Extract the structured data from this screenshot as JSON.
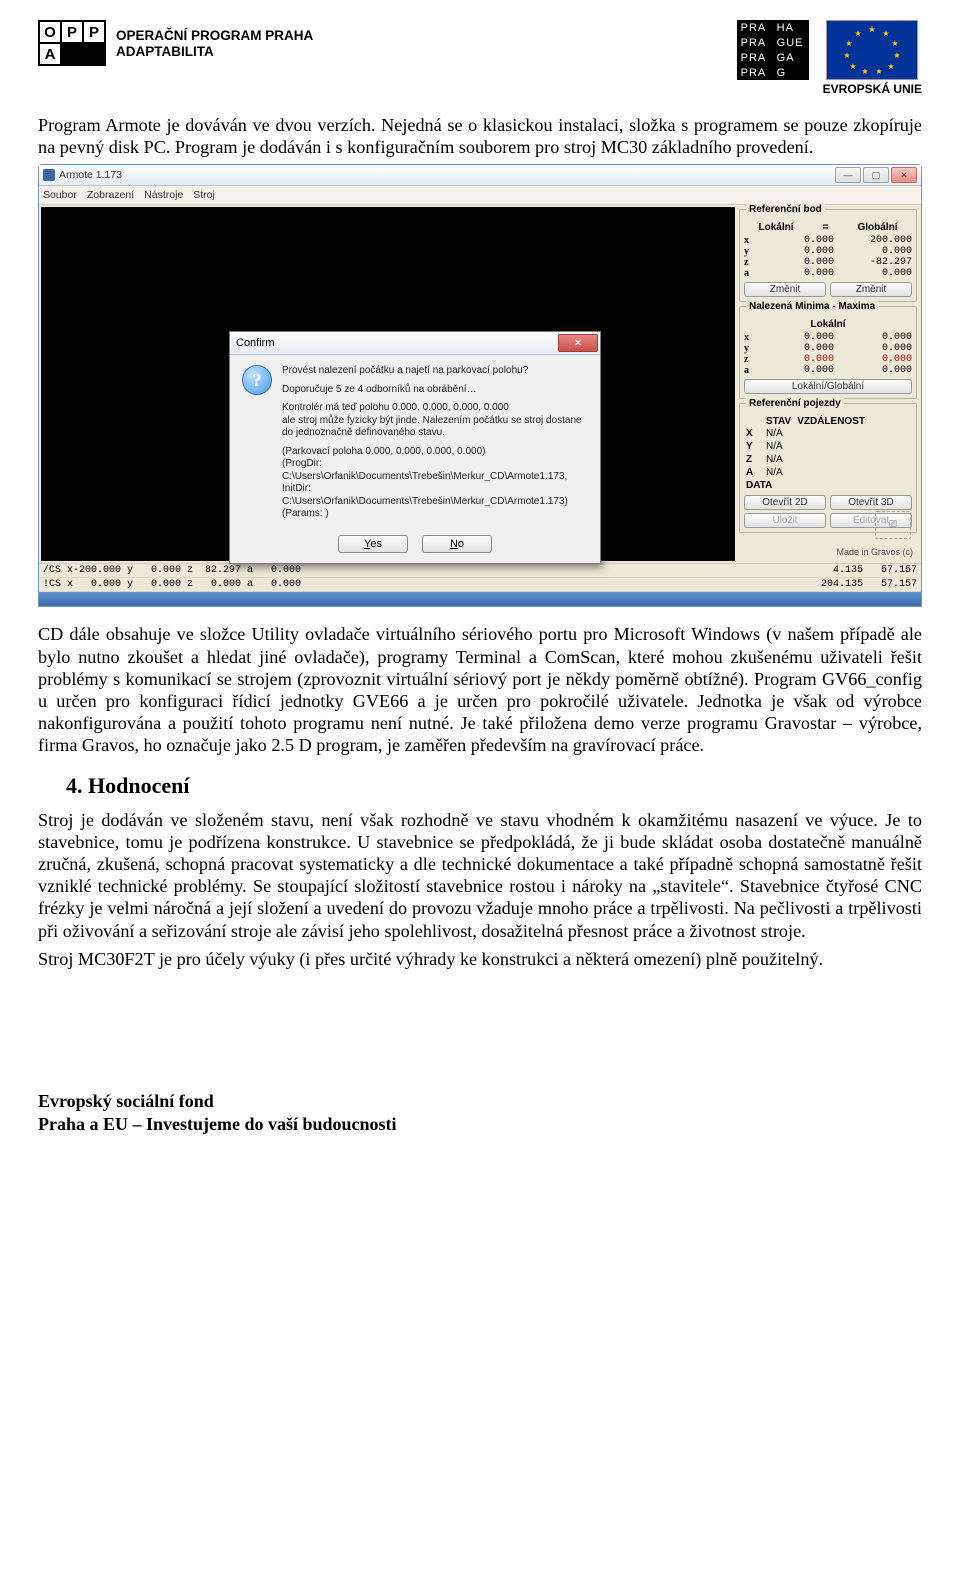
{
  "header": {
    "opp_letters": [
      "O",
      "P",
      "P",
      "A",
      "",
      ""
    ],
    "opp_title_l1": "OPERAČNÍ PROGRAM PRAHA",
    "opp_title_l2": "ADAPTABILITA",
    "praha_cells": [
      "PRA",
      "HA",
      "PRA",
      "GUE",
      "PRA",
      "GA",
      "PRA",
      "G"
    ],
    "eu_label": "EVROPSKÁ UNIE"
  },
  "body": {
    "p1": "Program Armote je dováván ve dvou verzích. Nejedná se o klasickou instalaci, složka s programem se pouze zkopíruje na pevný disk PC. Program je dodáván i s konfiguračním souborem pro stroj MC30 základního provedení.",
    "p2": "CD dále obsahuje ve složce Utility ovladače virtuálního sériového portu pro Microsoft Windows (v našem případě ale bylo nutno zkoušet a hledat jiné ovladače), programy Terminal a ComScan, které mohou zkušenému uživateli řešit problémy s komunikací se strojem (zprovoznit virtuální sériový port je někdy poměrně obtížné). Program GV66_config u určen pro konfiguraci řídicí jednotky GVE66 a je určen pro pokročilé uživatele. Jednotka je však od výrobce nakonfigurována a použití tohoto programu není nutné. Je také přiložena demo verze programu Gravostar – výrobce, firma Gravos, ho označuje jako 2.5 D program, je zaměřen především na gravírovací práce.",
    "h2": "4. Hodnocení",
    "p3": "Stroj je dodáván ve složeném stavu, není však rozhodně ve stavu vhodném k okamžitému nasazení ve výuce. Je to stavebnice, tomu je podřízena konstrukce. U stavebnice se předpokládá, že ji bude skládat osoba dostatečně manuálně zručná, zkušená, schopná pracovat systematicky a dle technické dokumentace a také případně schopná samostatně řešit vzniklé technické problémy. Se stoupající složitostí stavebnice rostou i nároky na „stavitele“. Stavebnice čtyřosé CNC frézky je velmi náročná a její složení a uvedení do provozu vžaduje mnoho práce a trpělivosti. Na pečlivosti a trpělivosti při oživování a seřizování stroje ale závisí jeho spolehlivost, dosažitelná přesnost práce a životnost stroje.",
    "p4": "Stroj MC30F2T je pro účely výuky (i přes určité výhrady ke konstrukci a některá omezení) plně použitelný."
  },
  "footer": {
    "l1": "Evropský sociální fond",
    "l2": "Praha a EU – Investujeme do vaší budoucnosti"
  },
  "app": {
    "title": "Armote 1.173",
    "menu": [
      "Soubor",
      "Zobrazení",
      "Nástroje",
      "Stroj"
    ],
    "made": "Made in Gravos (c)",
    "panels": {
      "ref_point": {
        "title": "Referenční bod",
        "cols": [
          "Lokální",
          "=",
          "Globální"
        ],
        "rows": [
          {
            "axis": "x",
            "local": "0.000",
            "global": "200.000"
          },
          {
            "axis": "y",
            "local": "0.000",
            "global": "0.000"
          },
          {
            "axis": "z",
            "local": "0.000",
            "global": "-82.297"
          },
          {
            "axis": "a",
            "local": "0.000",
            "global": "0.000"
          }
        ],
        "btn": "Změnit"
      },
      "minmax": {
        "title": "Nalezená Minima - Maxima",
        "sub": "Lokální",
        "rows": [
          {
            "axis": "x",
            "min": "0.000",
            "max": "0.000"
          },
          {
            "axis": "y",
            "min": "0.000",
            "max": "0.000"
          },
          {
            "axis": "z",
            "min": "0.000",
            "max": "0.000"
          },
          {
            "axis": "a",
            "min": "0.000",
            "max": "0.000"
          }
        ],
        "btn": "Lokální/Globální"
      },
      "ref_moves": {
        "title": "Referenční pojezdy",
        "cols": [
          "STAV",
          "VZDÁLENOST"
        ],
        "rows": [
          {
            "axis": "X",
            "val": "N/A"
          },
          {
            "axis": "Y",
            "val": "N/A"
          },
          {
            "axis": "Z",
            "val": "N/A"
          },
          {
            "axis": "A",
            "val": "N/A"
          }
        ],
        "data_label": "DATA",
        "btns": [
          "Otevřít 2D",
          "Otevřít 3D",
          "Uložit",
          "Editovat"
        ]
      }
    },
    "status": {
      "row1_left": "/CS x-200.000 y   0.000 z  82.297 a   0.000",
      "row1_right": "4.135   57.157",
      "row2_left": "!CS x   0.000 y   0.000 z   0.000 a   0.000",
      "row2_right": "204.135   57.157"
    },
    "dialog": {
      "title": "Confirm",
      "l1": "Provést nalezení počátku a najetí na parkovací polohu?",
      "l2": "Doporučuje 5 ze 4 odborníků na obrábění…",
      "l3": "Kontrolér má teď polohu  0.000,  0.000,  0.000,  0.000",
      "l4": "ale stroj může fyzicky být jinde. Nalezením počátku se stroj dostane do jednoznačně definovaného stavu.",
      "l5": "(Parkovací poloha 0.000,  0.000,  0.000,  0.000)",
      "l6": "(ProgDir: C:\\Users\\Orfanik\\Documents\\Trebešin\\Merkur_CD\\Armote1.173,  InitDir: C:\\Users\\Orfanik\\Documents\\Trebešin\\Merkur_CD\\Armote1.173)",
      "l7": "(Params: )",
      "yes": "Yes",
      "no": "No"
    }
  }
}
